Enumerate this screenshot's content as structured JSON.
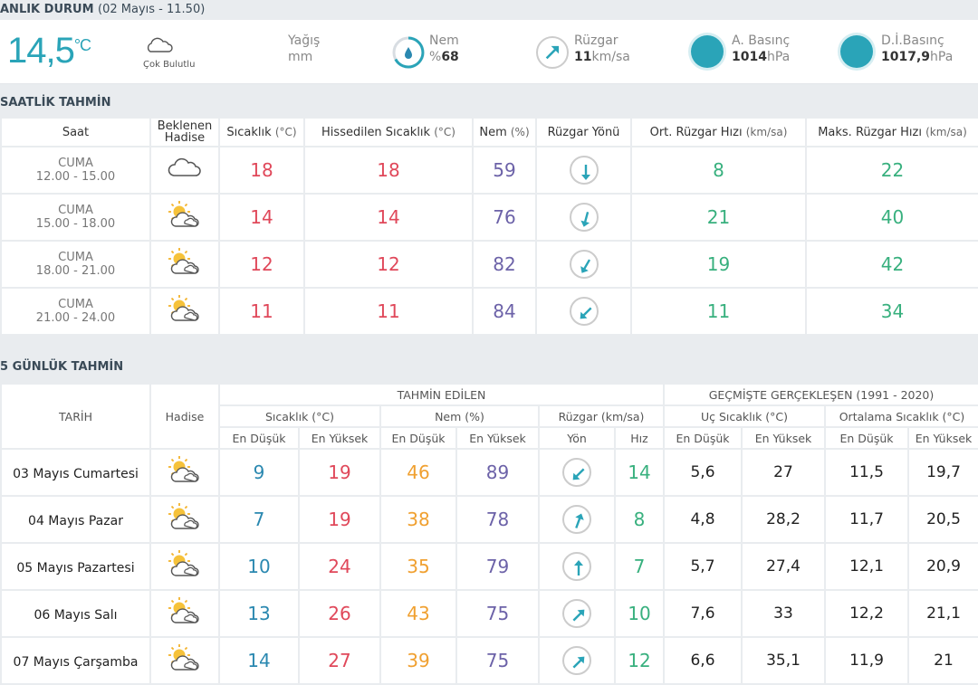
{
  "current": {
    "header_title": "ANLIK DURUM",
    "header_time": "(02 Mayıs - 11.50)",
    "temp": "14,5",
    "temp_unit": "°C",
    "condition": "Çok Bulutlu",
    "rain_label": "Yağış",
    "rain_unit": "mm",
    "humidity_label": "Nem",
    "humidity_prefix": "%",
    "humidity_value": "68",
    "wind_label": "Rüzgar",
    "wind_value": "11",
    "wind_unit": "km/sa",
    "pressure_label": "A. Basınç",
    "pressure_value": "1014",
    "pressure_unit": "hPa",
    "sea_pressure_label": "D.İ.Basınç",
    "sea_pressure_value": "1017,9",
    "sea_pressure_unit": "hPa",
    "accent": "#2aa4b8"
  },
  "hourly": {
    "title": "SAATLİK TAHMİN",
    "headers": {
      "time": "Saat",
      "event_1": "Beklenen",
      "event_2": "Hadise",
      "temp": "Sıcaklık",
      "temp_unit": "(°C)",
      "feels": "Hissedilen Sıcaklık",
      "feels_unit": "(°C)",
      "humidity": "Nem",
      "humidity_unit": "(%)",
      "wind_dir": "Rüzgar Yönü",
      "avg_wind": "Ort. Rüzgar Hızı",
      "avg_wind_unit": "(km/sa)",
      "max_wind": "Maks. Rüzgar Hızı",
      "max_wind_unit": "(km/sa)"
    },
    "rows": [
      {
        "day": "CUMA",
        "range": "12.00 - 15.00",
        "icon": "cloudy-icon",
        "temp": "18",
        "feels": "18",
        "humidity": "59",
        "dir": 180,
        "avg": "8",
        "max": "22"
      },
      {
        "day": "CUMA",
        "range": "15.00 - 18.00",
        "icon": "partly-cloudy-icon",
        "temp": "14",
        "feels": "14",
        "humidity": "76",
        "dir": 195,
        "avg": "21",
        "max": "40"
      },
      {
        "day": "CUMA",
        "range": "18.00 - 21.00",
        "icon": "partly-cloudy-icon",
        "temp": "12",
        "feels": "12",
        "humidity": "82",
        "dir": 210,
        "avg": "19",
        "max": "42"
      },
      {
        "day": "CUMA",
        "range": "21.00 - 24.00",
        "icon": "partly-cloudy-icon",
        "temp": "11",
        "feels": "11",
        "humidity": "84",
        "dir": 225,
        "avg": "11",
        "max": "34"
      }
    ]
  },
  "daily": {
    "title": "5 GÜNLÜK TAHMİN",
    "headers": {
      "date": "TARİH",
      "event": "Hadise",
      "forecast": "TAHMİN EDİLEN",
      "history": "GEÇMİŞTE GERÇEKLEŞEN (1991 - 2020)",
      "temp": "Sıcaklık (°C)",
      "humidity": "Nem (%)",
      "wind": "Rüzgar (km/sa)",
      "extreme": "Uç Sıcaklık (°C)",
      "mean": "Ortalama Sıcaklık (°C)",
      "low": "En Düşük",
      "high": "En Yüksek",
      "dir": "Yön",
      "speed": "Hız"
    },
    "rows": [
      {
        "date": "03 Mayıs Cumartesi",
        "t_low": "9",
        "t_high": "19",
        "h_low": "46",
        "h_high": "89",
        "dir": 225,
        "speed": "14",
        "x_low": "5,6",
        "x_high": "27",
        "m_low": "11,5",
        "m_high": "19,7"
      },
      {
        "date": "04 Mayıs Pazar",
        "t_low": "7",
        "t_high": "19",
        "h_low": "38",
        "h_high": "78",
        "dir": 20,
        "speed": "8",
        "x_low": "4,8",
        "x_high": "28,2",
        "m_low": "11,7",
        "m_high": "20,5"
      },
      {
        "date": "05 Mayıs Pazartesi",
        "t_low": "10",
        "t_high": "24",
        "h_low": "35",
        "h_high": "79",
        "dir": 0,
        "speed": "7",
        "x_low": "5,7",
        "x_high": "27,4",
        "m_low": "12,1",
        "m_high": "20,9"
      },
      {
        "date": "06 Mayıs Salı",
        "t_low": "13",
        "t_high": "26",
        "h_low": "43",
        "h_high": "75",
        "dir": 45,
        "speed": "10",
        "x_low": "7,6",
        "x_high": "33",
        "m_low": "12,2",
        "m_high": "21,1"
      },
      {
        "date": "07 Mayıs Çarşamba",
        "t_low": "14",
        "t_high": "27",
        "h_low": "39",
        "h_high": "75",
        "dir": 45,
        "speed": "12",
        "x_low": "6,6",
        "x_high": "35,1",
        "m_low": "11,9",
        "m_high": "21"
      }
    ]
  }
}
